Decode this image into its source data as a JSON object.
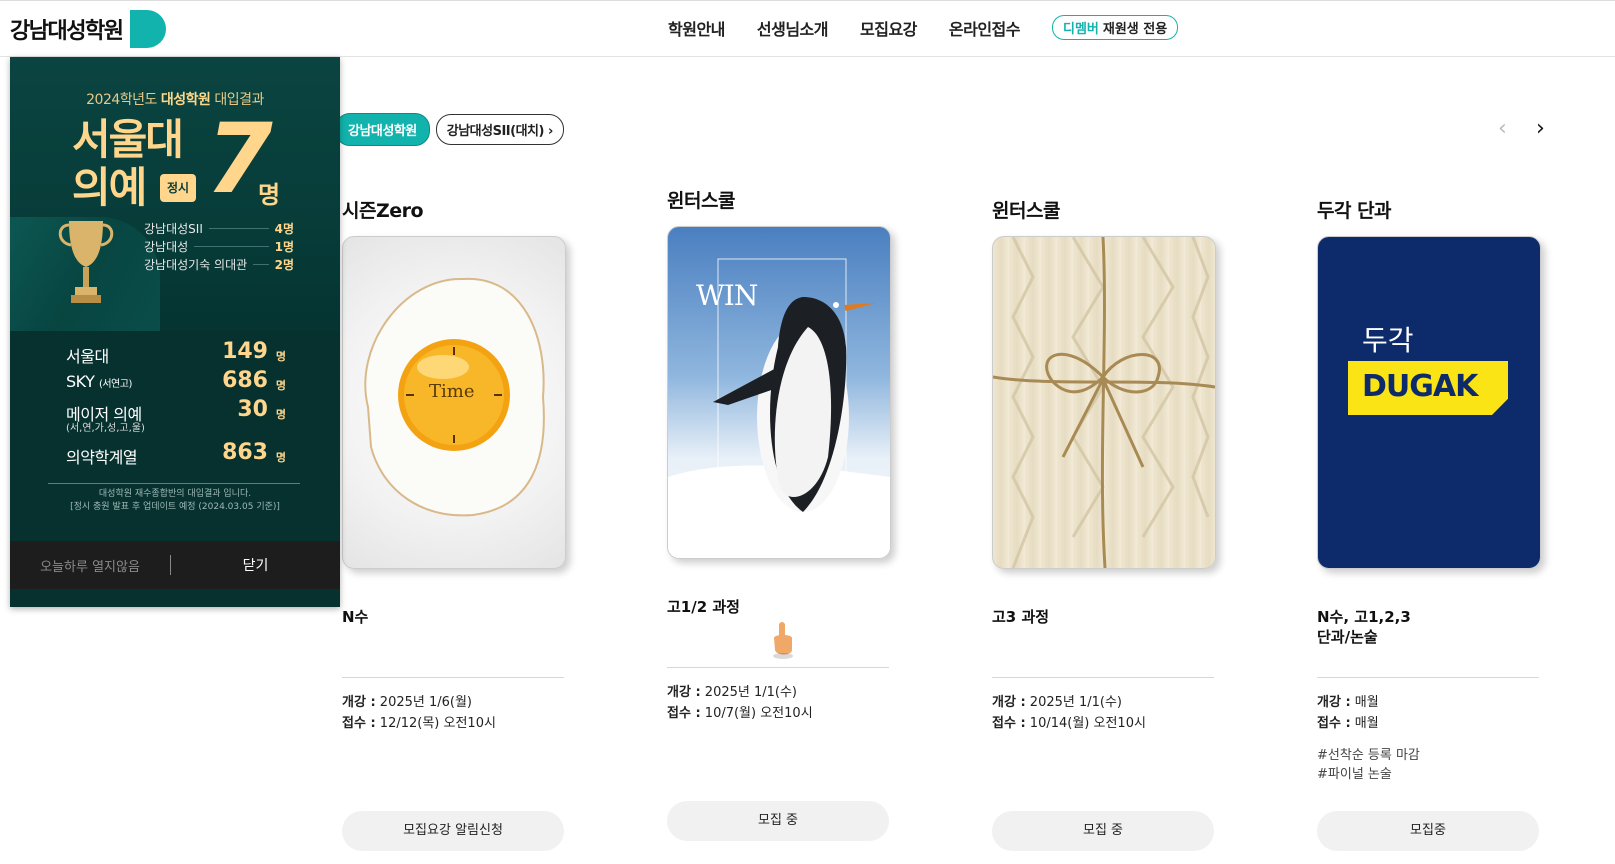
{
  "header": {
    "logo": "강남대성학원",
    "nav": [
      "학원안내",
      "선생님소개",
      "모집요강",
      "온라인접수"
    ],
    "pill_accent": "디멤버",
    "pill_text": "재원생 전용"
  },
  "popup": {
    "subtitle_year": "2024학년도",
    "subtitle_bold": "대성학원",
    "subtitle_rest": "대입결과",
    "big_line1": "서울대",
    "big_line2": "의예",
    "badge": "정시",
    "big_number": "7",
    "big_unit": "명",
    "breakdown": [
      {
        "name": "강남대성SII",
        "value": "4명"
      },
      {
        "name": "강남대성",
        "value": "1명"
      },
      {
        "name": "강남대성기숙 의대관",
        "value": "2명"
      }
    ],
    "stats": [
      {
        "name": "서울대",
        "extra": "",
        "sub": "",
        "value": "149",
        "unit": "명"
      },
      {
        "name": "SKY",
        "extra": "(서연고)",
        "sub": "",
        "value": "686",
        "unit": "명"
      },
      {
        "name": "메이저 의예",
        "extra": "",
        "sub": "(서,연,가,성,고,울)",
        "value": "30",
        "unit": "명"
      },
      {
        "name": "의약학계열",
        "extra": "",
        "sub": "",
        "value": "863",
        "unit": "명"
      }
    ],
    "note1": "대성학원 재수종합반의 대입결과 입니다.",
    "note2": "[정시 충원 발표 후 업데이트 예정 (2024.03.05 기준)]",
    "footer_left": "오늘하루 열지않음",
    "footer_right": "닫기"
  },
  "filters": {
    "active": "강남대성학원",
    "other": "강남대성SII(대치)",
    "other_arrow": "›"
  },
  "carousel": {
    "prev": "‹",
    "next": "›"
  },
  "cards": [
    {
      "title": "시즌Zero",
      "image_text": "Time",
      "target": [
        "N수"
      ],
      "open_label": "개강 :",
      "open_value": "2025년 1/6(월)",
      "apply_label": "접수 :",
      "apply_value": "12/12(목) 오전10시",
      "tags": [],
      "button": "모집요강 알림신청"
    },
    {
      "title": "윈터스쿨",
      "image_text": "WIN",
      "target": [
        "고1/2 과정"
      ],
      "open_label": "개강 :",
      "open_value": "2025년 1/1(수)",
      "apply_label": "접수 :",
      "apply_value": "10/7(월) 오전10시",
      "tags": [],
      "button": "모집 중"
    },
    {
      "title": "윈터스쿨",
      "image_text": "",
      "target": [
        "고3 과정"
      ],
      "open_label": "개강 :",
      "open_value": "2025년 1/1(수)",
      "apply_label": "접수 :",
      "apply_value": "10/14(월) 오전10시",
      "tags": [],
      "button": "모집 중"
    },
    {
      "title": "두각 단과",
      "image_text": "두각",
      "image_text2": "DUGAK",
      "target": [
        "N수, 고1,2,3",
        "단과/논술"
      ],
      "open_label": "개강 :",
      "open_value": "매월",
      "apply_label": "접수 :",
      "apply_value": "매월",
      "tags": [
        "#선착순 등록 마감",
        "#파이널 논술"
      ],
      "button": "모집중"
    }
  ],
  "colors": {
    "accent": "#13b3ad",
    "popup_bg": "#06312f",
    "gold": "#ffd68c",
    "dugak_bg": "#0d2a6b",
    "dugak_yellow": "#fbe415"
  },
  "icons": [
    "pointing-hand-icon",
    "chevron-left-icon",
    "chevron-right-icon",
    "trophy-icon"
  ]
}
